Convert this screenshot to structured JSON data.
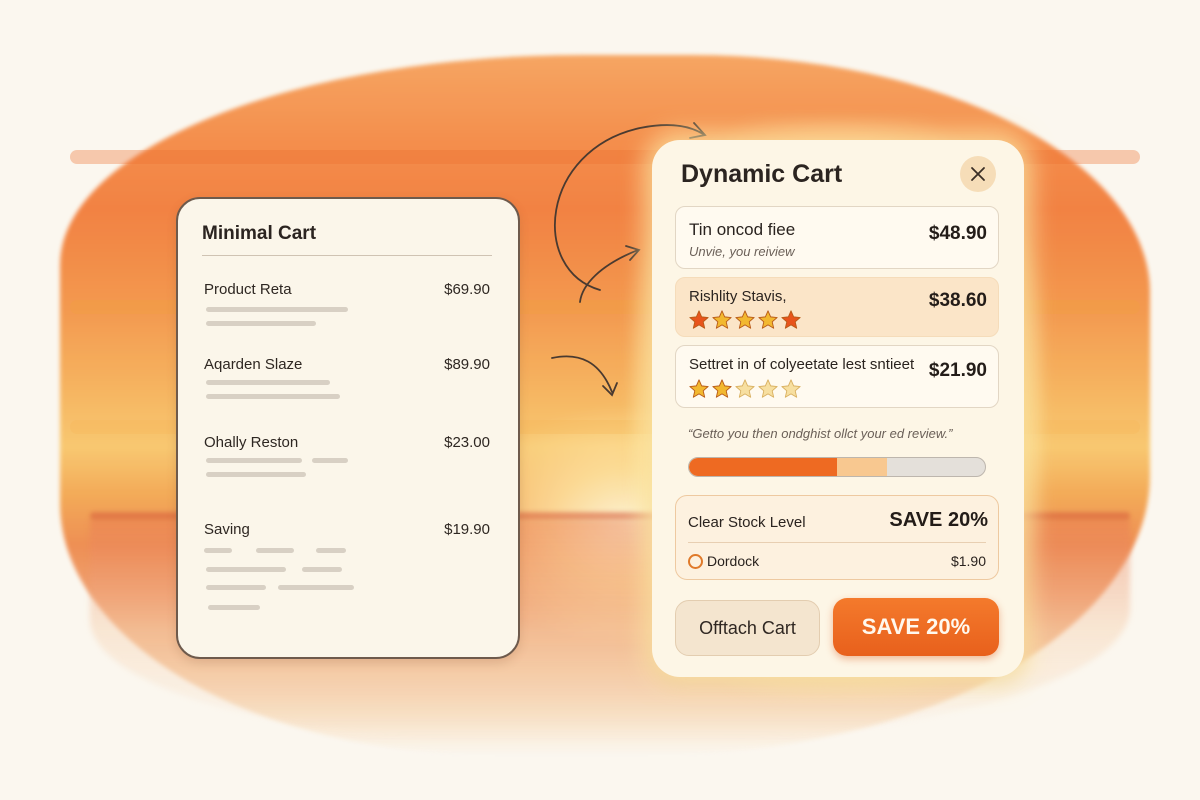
{
  "minimal_cart": {
    "title": "Minimal Cart",
    "items": [
      {
        "name": "Product Reta",
        "price": "$69.90"
      },
      {
        "name": "Aqarden Slaze",
        "price": "$89.90"
      },
      {
        "name": "Ohally Reston",
        "price": "$23.00"
      },
      {
        "name": "Saving",
        "price": "$19.90"
      }
    ]
  },
  "dynamic_cart": {
    "title": "Dynamic Cart",
    "close_icon": "close-icon",
    "items": [
      {
        "title": "Tin oncod fiee",
        "subtitle": "Unvie, you reiview",
        "price": "$48.90"
      },
      {
        "title": "Rishlity Stavis,",
        "price": "$38.60",
        "rating": 5,
        "star_color": "#e8541c"
      },
      {
        "title": "Settret in of colyeetate lest sntieet",
        "price": "$21.90",
        "rating": 2,
        "star_color": "#f2b830"
      }
    ],
    "review_quote": "“Getto you then ondghist ollct your ed review.”",
    "progress": {
      "primary": 0.5,
      "secondary": 0.67
    },
    "stock": {
      "label": "Clear Stock Level",
      "save_badge": "SAVE 20%",
      "option_label": "Dordock",
      "option_price": "$1.90"
    },
    "buttons": {
      "detach": "Offtach Cart",
      "save": "SAVE 20%"
    }
  },
  "colors": {
    "accent": "#ee6a22",
    "panel": "#fdf6e6",
    "sunset": "#f27c3a"
  }
}
